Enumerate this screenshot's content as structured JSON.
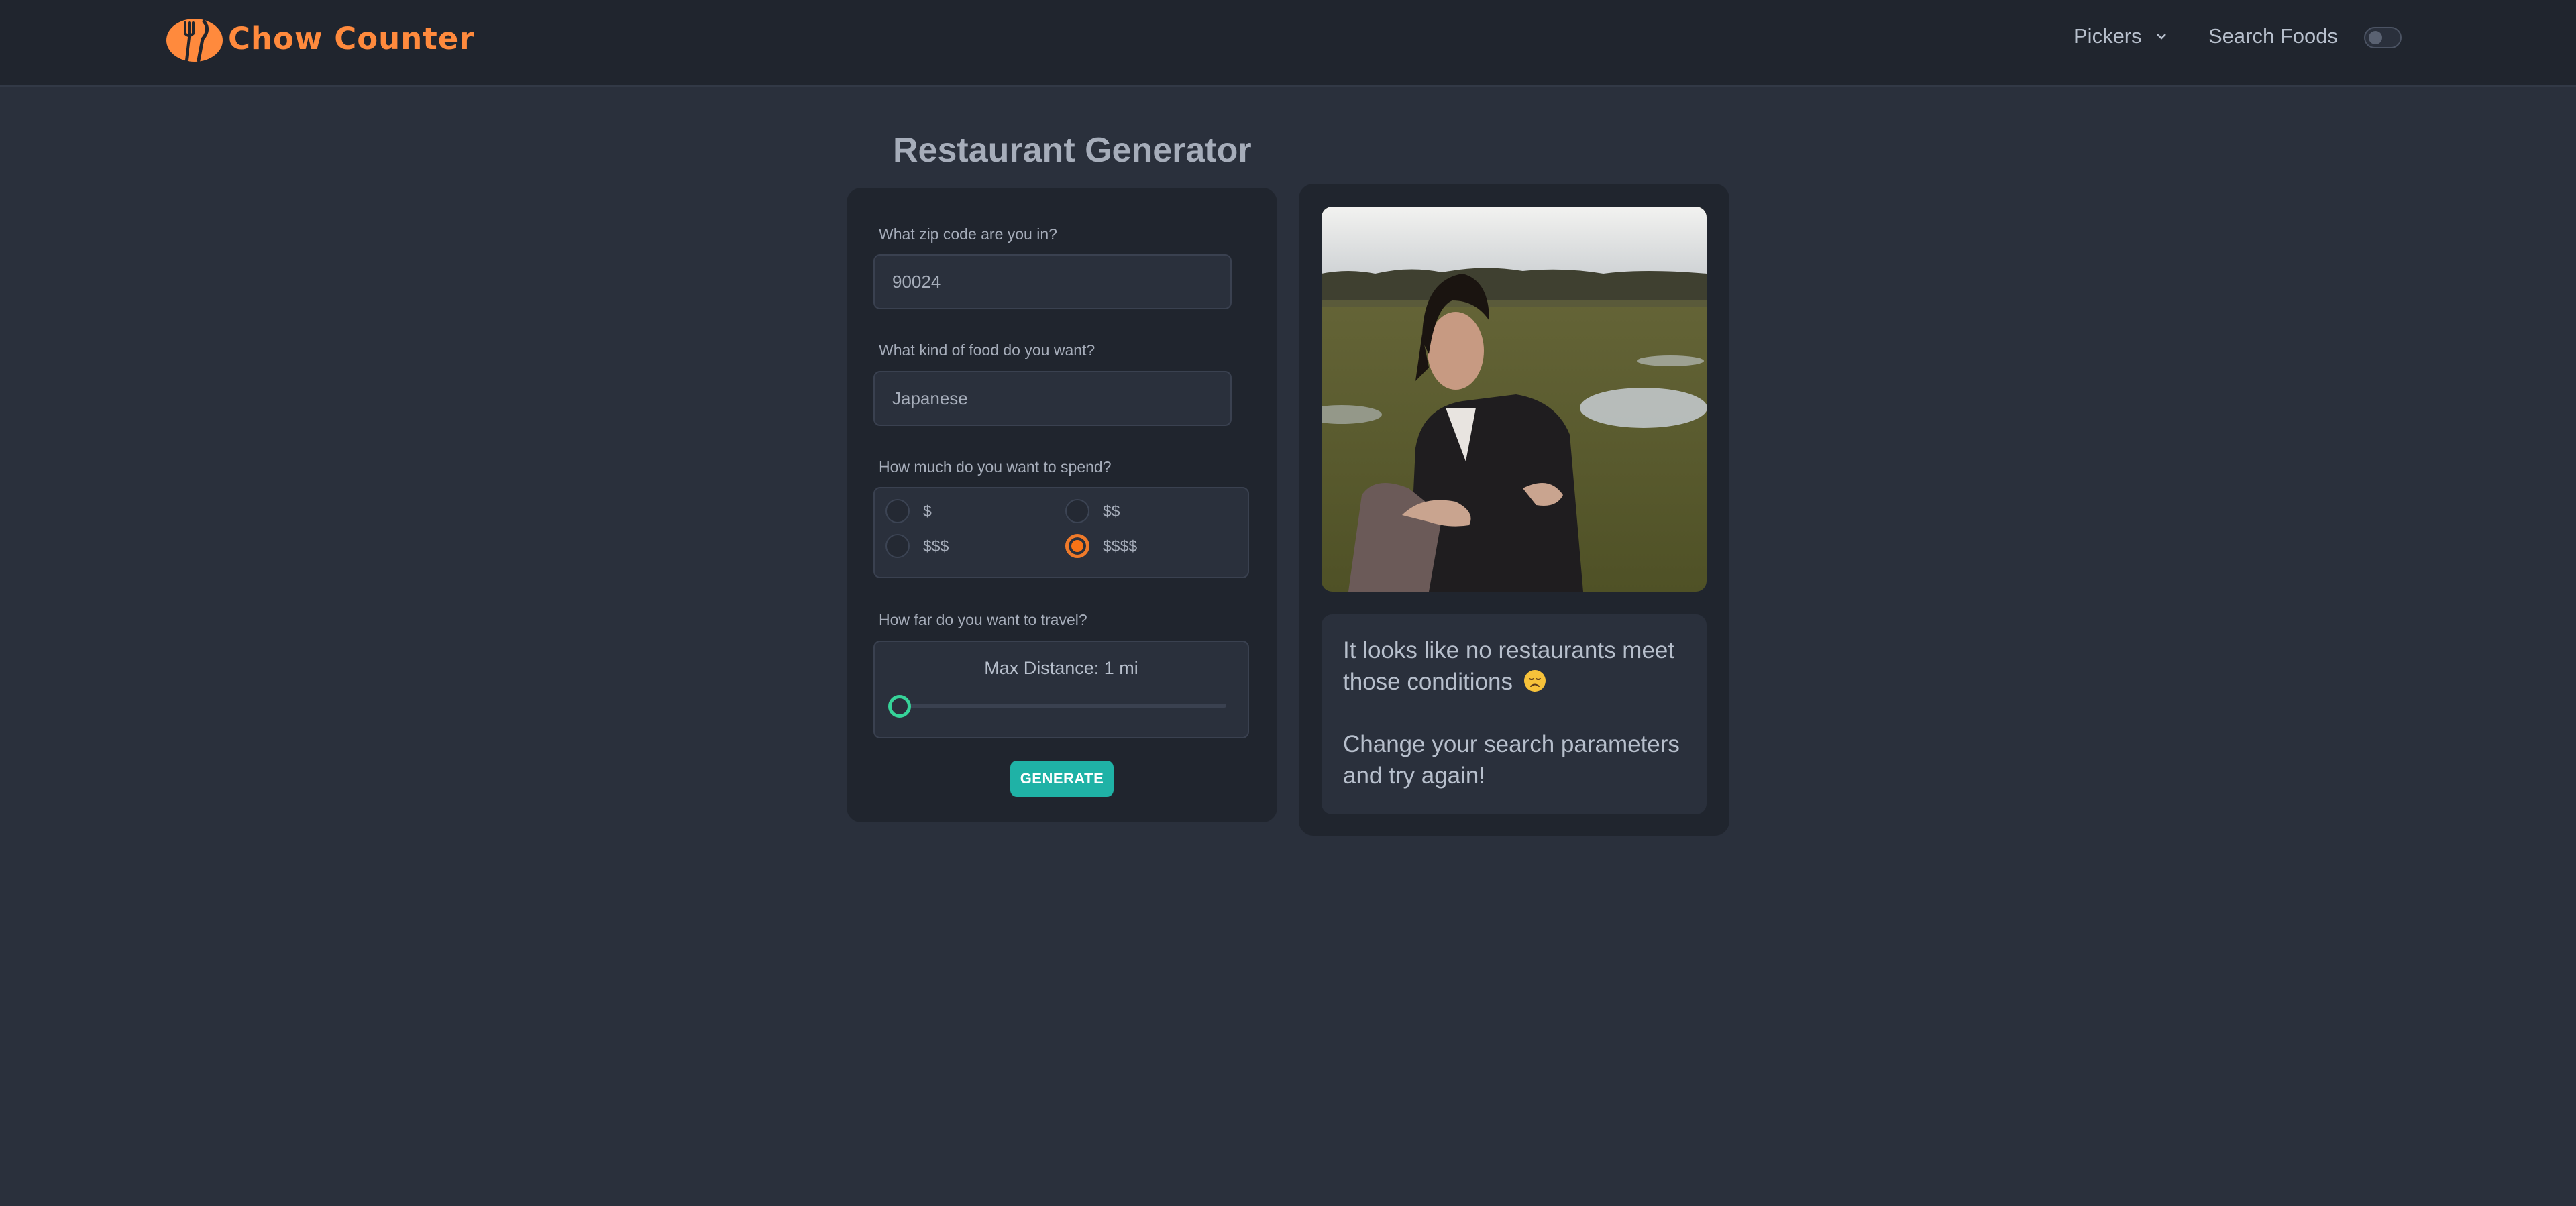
{
  "nav": {
    "brand": "Chow Counter",
    "pickers_label": "Pickers",
    "search_label": "Search Foods"
  },
  "page": {
    "title": "Restaurant Generator"
  },
  "form": {
    "zip_label": "What zip code are you in?",
    "zip_value": "90024",
    "food_label": "What kind of food do you want?",
    "food_value": "Japanese",
    "spend_label": "How much do you want to spend?",
    "price_options": [
      {
        "label": "$",
        "selected": false
      },
      {
        "label": "$$",
        "selected": false
      },
      {
        "label": "$$$",
        "selected": false
      },
      {
        "label": "$$$$",
        "selected": true
      }
    ],
    "travel_label": "How far do you want to travel?",
    "distance_text": "Max Distance: 1 mi",
    "distance_slider_fraction": 0.0,
    "generate_label": "GENERATE"
  },
  "result": {
    "message_line1": "It looks like no restaurants meet those conditions",
    "message_line2": "Change your search parameters and try again!",
    "emoji": "disappointed-face-icon"
  },
  "colors": {
    "accent": "#ff8a3d",
    "primary_button": "#1fb2a6",
    "slider": "#36d399",
    "radio_selected": "#f97316",
    "background": "#2a303c",
    "card": "#20252e"
  }
}
